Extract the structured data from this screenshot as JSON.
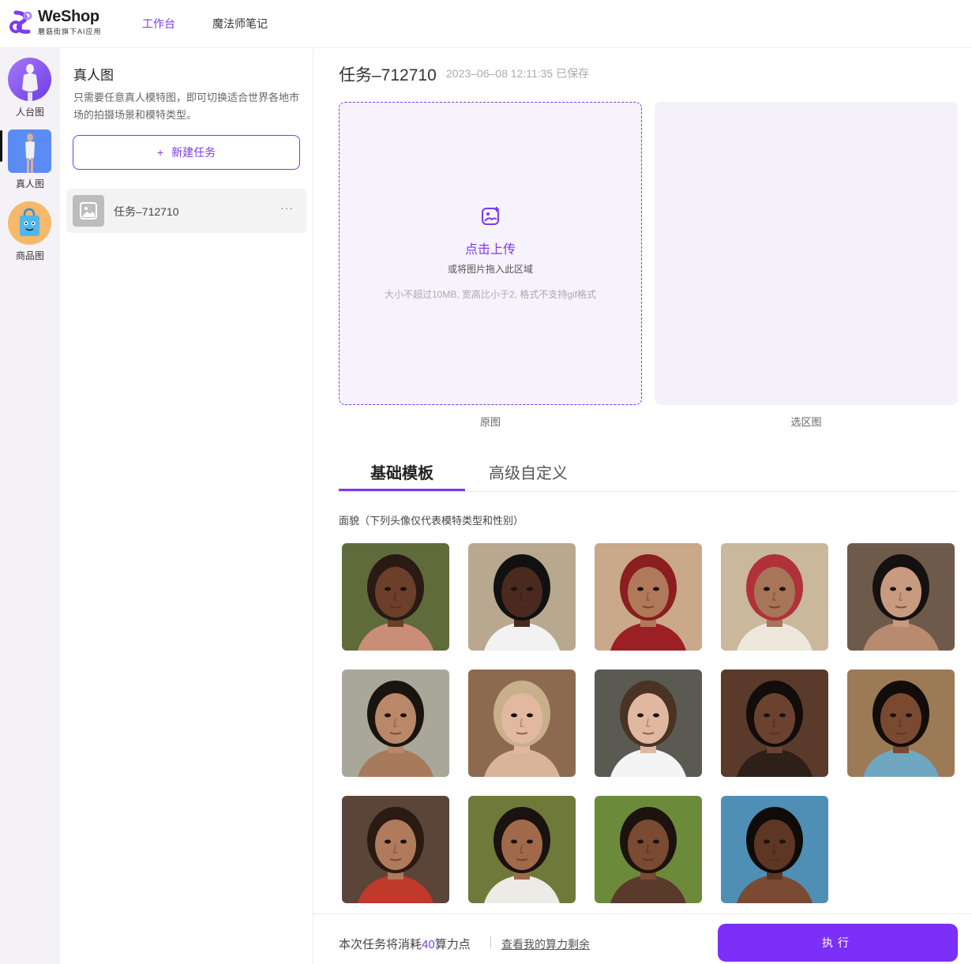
{
  "brand": {
    "name": "WeShop",
    "subtitle": "蘑菇街旗下AI应用",
    "accent": "#7c3aed"
  },
  "nav": {
    "items": [
      {
        "label": "工作台",
        "active": true
      },
      {
        "label": "魔法师笔记",
        "active": false
      }
    ]
  },
  "rail": {
    "items": [
      {
        "label": "人台图",
        "icon": "mannequin-avatar"
      },
      {
        "label": "真人图",
        "icon": "model-avatar",
        "active": true
      },
      {
        "label": "商品图",
        "icon": "shopping-bag-avatar"
      }
    ]
  },
  "task_panel": {
    "title": "真人图",
    "description": "只需要任意真人模特图，即可切换适合世界各地市场的拍摄场景和模特类型。",
    "new_task_label": "新建任务",
    "new_task_icon": "+",
    "tasks": [
      {
        "name": "任务–712710",
        "more": "···"
      }
    ]
  },
  "main": {
    "task_title": "任务–712710",
    "saved_text": "2023–06–08 12:11:35 已保存",
    "upload": {
      "title": "点击上传",
      "subtitle": "或将图片拖入此区域",
      "hint": "大小不超过10MB, 宽高比小于2, 格式不支持gif格式",
      "caption": "原图"
    },
    "selection": {
      "caption": "选区图"
    },
    "tabs": [
      {
        "label": "基础模板",
        "active": true
      },
      {
        "label": "高级自定义",
        "active": false
      }
    ],
    "section_label": "面貌（下列头像仅代表模特类型和性别）",
    "faces": [
      {
        "skin": "#6b3f2a",
        "hair": "#2a1a14",
        "bg": "#5f6b3a",
        "cloth": "#c98d78"
      },
      {
        "skin": "#4a2a1e",
        "hair": "#111111",
        "bg": "#b8a88f",
        "cloth": "#f2f2f2"
      },
      {
        "skin": "#b07a5a",
        "hair": "#8b1e1e",
        "bg": "#c9a98a",
        "cloth": "#9c1f26"
      },
      {
        "skin": "#a77557",
        "hair": "#b0313a",
        "bg": "#c9b89b",
        "cloth": "#eee8dc"
      },
      {
        "skin": "#c89b80",
        "hair": "#151110",
        "bg": "#6e5a4b",
        "cloth": "#b88a70"
      },
      {
        "skin": "#b98868",
        "hair": "#1a1410",
        "bg": "#a8a79a",
        "cloth": "#a87a5c"
      },
      {
        "skin": "#e2b9a0",
        "hair": "#c9b08a",
        "bg": "#8d6a4f",
        "cloth": "#d9b49a"
      },
      {
        "skin": "#e0b8a0",
        "hair": "#4a3324",
        "bg": "#5a5a52",
        "cloth": "#f4f4f4"
      },
      {
        "skin": "#6b4230",
        "hair": "#120c0a",
        "bg": "#5a3a2a",
        "cloth": "#2e1f18"
      },
      {
        "skin": "#7a4a30",
        "hair": "#120d0b",
        "bg": "#9c7a55",
        "cloth": "#6fa7c0"
      },
      {
        "skin": "#b07a5c",
        "hair": "#2b1a12",
        "bg": "#5a4538",
        "cloth": "#c0392b"
      },
      {
        "skin": "#a06a4a",
        "hair": "#1a1210",
        "bg": "#6f7a3a",
        "cloth": "#ecebe6"
      },
      {
        "skin": "#7a4a32",
        "hair": "#1c130f",
        "bg": "#6c8b3a",
        "cloth": "#5a3a2a"
      },
      {
        "skin": "#5e3624",
        "hair": "#0f0b09",
        "bg": "#4f8fb5",
        "cloth": "#7a4a32"
      }
    ]
  },
  "footer": {
    "cost_prefix": "本次任务将消耗",
    "cost_value": "40",
    "cost_suffix": "算力点",
    "balance_link": "查看我的算力剩余",
    "run_label": "执行"
  }
}
